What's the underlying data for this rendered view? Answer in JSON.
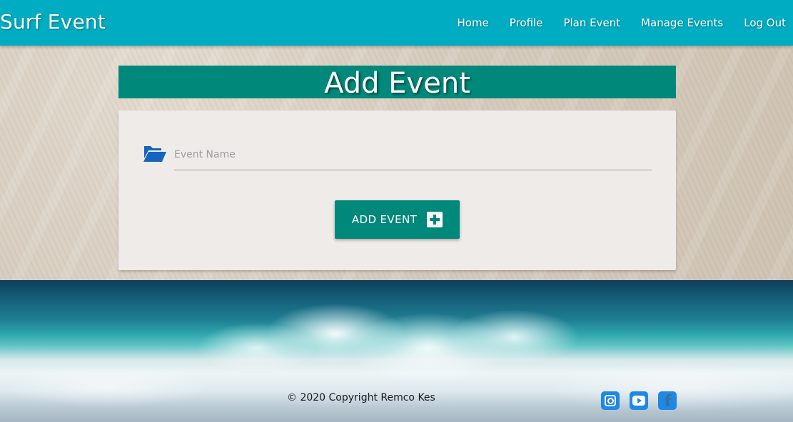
{
  "app": {
    "brand": "Surf Event"
  },
  "nav": {
    "items": [
      {
        "label": "Home"
      },
      {
        "label": "Profile"
      },
      {
        "label": "Plan Event"
      },
      {
        "label": "Manage Events"
      },
      {
        "label": "Log Out"
      }
    ]
  },
  "page": {
    "title": "Add Event"
  },
  "form": {
    "event_name": {
      "value": "",
      "placeholder": "Event Name",
      "icon": "folder-open-icon"
    },
    "submit": {
      "label": "ADD EVENT",
      "icon": "plus-square-icon"
    }
  },
  "footer": {
    "copyright": "© 2020 Copyright Remco Kes",
    "social": [
      {
        "icon": "instagram-icon"
      },
      {
        "icon": "youtube-icon"
      },
      {
        "icon": "facebook-icon"
      }
    ]
  },
  "colors": {
    "navbar": "#00acc1",
    "primary": "#00897b",
    "card": "#efebe9",
    "folder_icon": "#1565c0",
    "social_icon": "#1e88e5"
  }
}
